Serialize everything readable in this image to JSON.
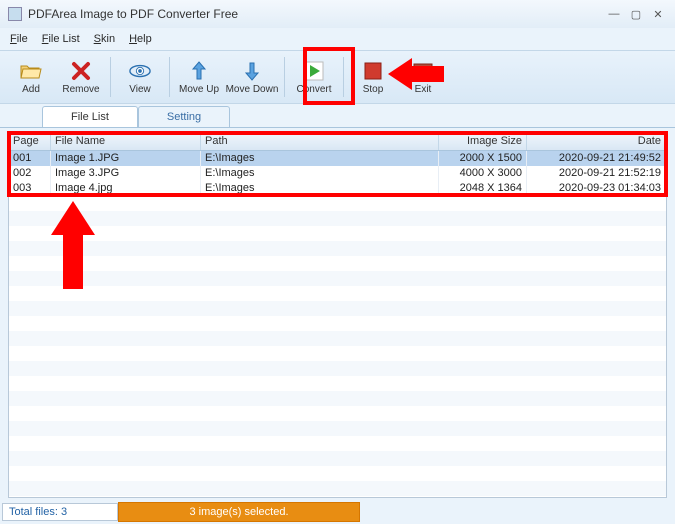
{
  "title": "PDFArea Image to PDF Converter Free",
  "menu": {
    "file": "File",
    "filelist": "File List",
    "skin": "Skin",
    "help": "Help"
  },
  "toolbar": {
    "add": "Add",
    "remove": "Remove",
    "view": "View",
    "moveup": "Move Up",
    "movedown": "Move Down",
    "convert": "Convert",
    "stop": "Stop",
    "exit": "Exit"
  },
  "tabs": {
    "filelist": "File List",
    "setting": "Setting"
  },
  "headers": {
    "page": "Page",
    "file": "File Name",
    "path": "Path",
    "size": "Image Size",
    "date": "Date"
  },
  "rows": [
    {
      "page": "001",
      "file": "Image 1.JPG",
      "path": "E:\\Images",
      "size": "2000 X 1500",
      "date": "2020-09-21 21:49:52"
    },
    {
      "page": "002",
      "file": "Image 3.JPG",
      "path": "E:\\Images",
      "size": "4000 X 3000",
      "date": "2020-09-21 21:52:19"
    },
    {
      "page": "003",
      "file": "Image 4.jpg",
      "path": "E:\\Images",
      "size": "2048 X 1364",
      "date": "2020-09-23 01:34:03"
    }
  ],
  "status": {
    "total": "Total files: 3",
    "selected": "3 image(s) selected."
  }
}
